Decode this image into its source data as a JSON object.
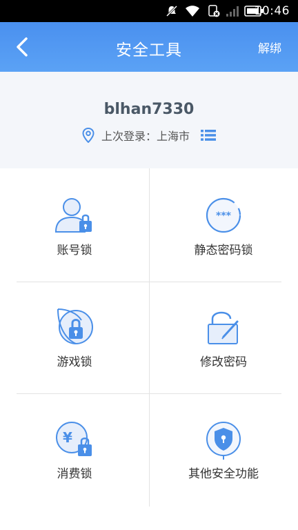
{
  "status_bar": {
    "time": "10:46"
  },
  "header": {
    "title": "安全工具",
    "right_action": "解绑"
  },
  "profile": {
    "username": "blhan7330",
    "last_login": "上次登录：上海市"
  },
  "tools": [
    {
      "label": "账号锁",
      "icon": "account-lock-icon"
    },
    {
      "label": "静态密码锁",
      "icon": "static-password-lock-icon"
    },
    {
      "label": "游戏锁",
      "icon": "game-lock-icon"
    },
    {
      "label": "修改密码",
      "icon": "edit-password-icon"
    },
    {
      "label": "消费锁",
      "icon": "consume-lock-icon"
    },
    {
      "label": "其他安全功能",
      "icon": "security-shield-icon"
    }
  ],
  "colors": {
    "accent": "#4a90ef",
    "icon_blue": "#4a8fe8",
    "icon_fill": "#e6eefb"
  }
}
